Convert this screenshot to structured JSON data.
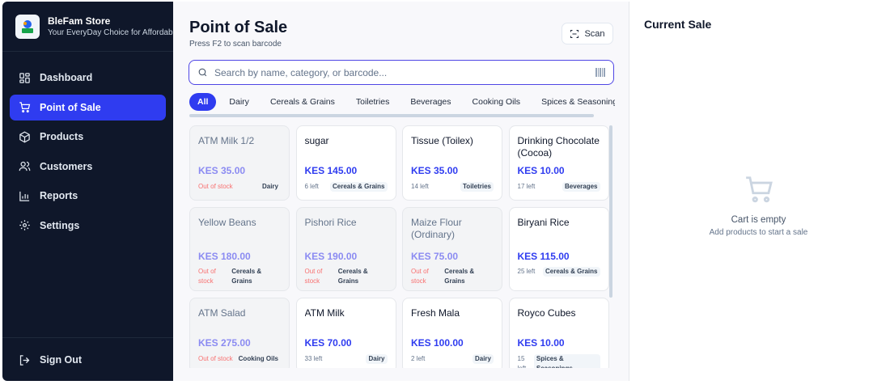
{
  "brand": {
    "name": "BleFam Store",
    "tagline": "Your EveryDay Choice for Affordable"
  },
  "nav": {
    "dashboard": "Dashboard",
    "pos": "Point of Sale",
    "products": "Products",
    "customers": "Customers",
    "reports": "Reports",
    "settings": "Settings",
    "signout": "Sign Out"
  },
  "header": {
    "title": "Point of Sale",
    "subtitle": "Press F2 to scan barcode",
    "scan_label": "Scan"
  },
  "search": {
    "placeholder": "Search by name, category, or barcode..."
  },
  "categories": [
    "All",
    "Dairy",
    "Cereals & Grains",
    "Toiletries",
    "Beverages",
    "Cooking Oils",
    "Spices & Seasonings"
  ],
  "products": [
    {
      "name": "ATM Milk 1/2",
      "price": "KES 35.00",
      "stock": "Out of stock",
      "category": "Dairy"
    },
    {
      "name": "sugar",
      "price": "KES 145.00",
      "stock": "6 left",
      "category": "Cereals & Grains"
    },
    {
      "name": "Tissue (Toilex)",
      "price": "KES 35.00",
      "stock": "14 left",
      "category": "Toiletries"
    },
    {
      "name": "Drinking Chocolate (Cocoa)",
      "price": "KES 10.00",
      "stock": "17 left",
      "category": "Beverages"
    },
    {
      "name": "Yellow Beans",
      "price": "KES 180.00",
      "stock": "Out of stock",
      "category": "Cereals & Grains"
    },
    {
      "name": "Pishori Rice",
      "price": "KES 190.00",
      "stock": "Out of stock",
      "category": "Cereals & Grains"
    },
    {
      "name": "Maize Flour (Ordinary)",
      "price": "KES 75.00",
      "stock": "Out of stock",
      "category": "Cereals & Grains"
    },
    {
      "name": "Biryani Rice",
      "price": "KES 115.00",
      "stock": "25 left",
      "category": "Cereals & Grains"
    },
    {
      "name": "ATM Salad",
      "price": "KES 275.00",
      "stock": "Out of stock",
      "category": "Cooking Oils"
    },
    {
      "name": "ATM Milk",
      "price": "KES 70.00",
      "stock": "33 left",
      "category": "Dairy"
    },
    {
      "name": "Fresh Mala",
      "price": "KES 100.00",
      "stock": "2 left",
      "category": "Dairy"
    },
    {
      "name": "Royco Cubes",
      "price": "KES 10.00",
      "stock": "15 left",
      "category": "Spices & Seasonings"
    }
  ],
  "cart": {
    "title": "Current Sale",
    "empty_title": "Cart is empty",
    "empty_sub": "Add products to start a sale"
  },
  "colors": {
    "sidebar": "#0f172a",
    "accent": "#2f3cf0",
    "out_of_stock": "#f87171"
  }
}
